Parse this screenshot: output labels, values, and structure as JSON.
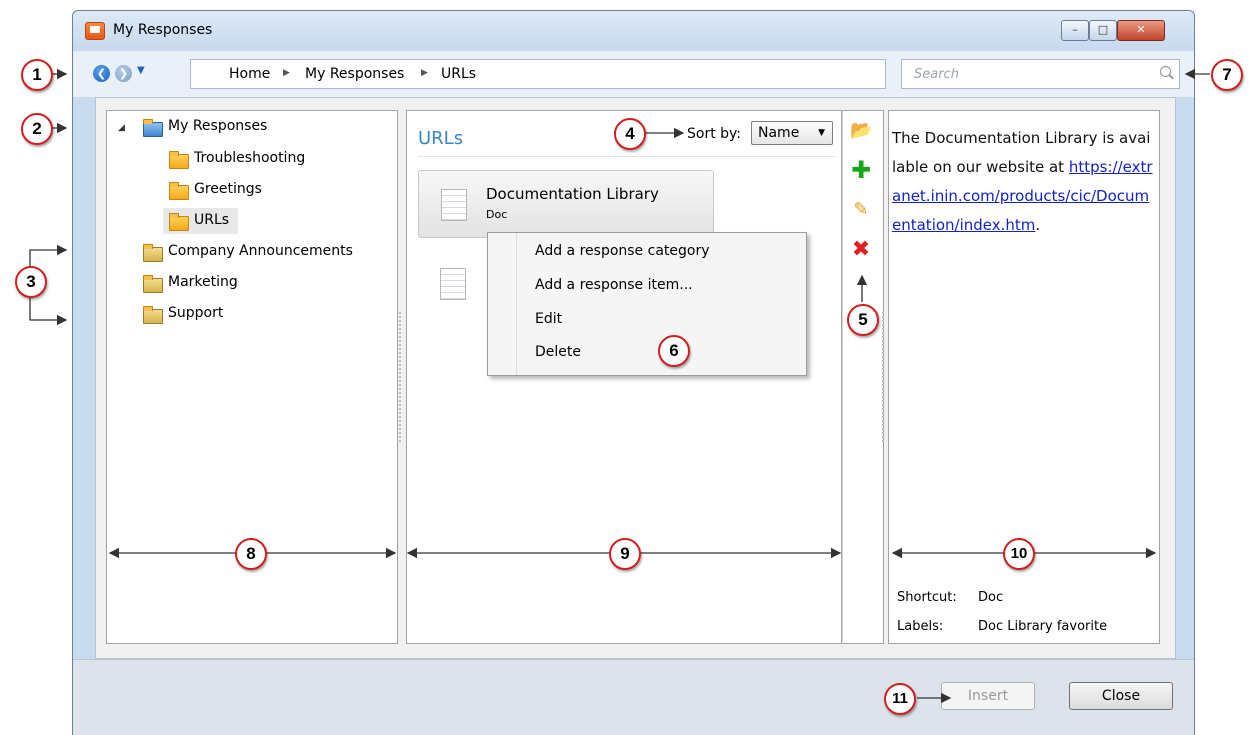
{
  "window": {
    "title": "My Responses"
  },
  "toolbar": {
    "breadcrumb": [
      "Home",
      "My Responses",
      "URLs"
    ],
    "search_placeholder": "Search"
  },
  "tree": {
    "root": "My Responses",
    "children": [
      "Troubleshooting",
      "Greetings",
      "URLs"
    ],
    "shared": [
      "Company Announcements",
      "Marketing",
      "Support"
    ]
  },
  "list": {
    "heading": "URLs",
    "sort_label": "Sort by:",
    "sort_value": "Name",
    "items": [
      {
        "title": "Documentation Library",
        "subtitle": "Doc"
      }
    ]
  },
  "context_menu": {
    "items": [
      "Add a response category",
      "Add a response item...",
      "Edit",
      "Delete"
    ]
  },
  "details": {
    "text": "The Documentation Library is available on our website at",
    "link": "https://extranet.inin.com/products/cic/Documentation/index.htm",
    "trailing": ".",
    "shortcut_label": "Shortcut:",
    "shortcut_value": "Doc",
    "labels_label": "Labels:",
    "labels_value": "Doc Library favorite"
  },
  "footer": {
    "insert_label": "Insert",
    "close_label": "Close"
  },
  "callouts": [
    "1",
    "2",
    "3",
    "4",
    "5",
    "6",
    "7",
    "8",
    "9",
    "10",
    "11"
  ],
  "icons": {
    "app": "response-app-icon",
    "nav_back": "back-arrow-icon",
    "nav_forward": "forward-arrow-icon",
    "search": "magnifier-icon",
    "add_category": "folder-add-icon",
    "add_item": "green-plus-icon",
    "edit": "pencil-icon",
    "delete": "red-x-icon",
    "document": "document-icon"
  },
  "colors": {
    "callout_border": "#d11f1f",
    "link": "#1122cc",
    "heading": "#3a86c8"
  }
}
